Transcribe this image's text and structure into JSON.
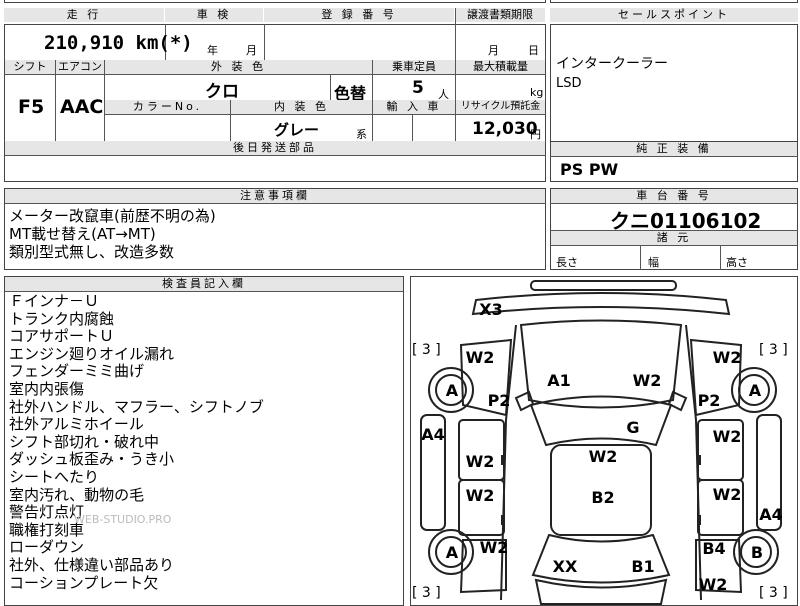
{
  "header": {
    "mileage_label": "走 行",
    "inspection_label": "車 検",
    "registration_label": "登 録 番 号",
    "transfer_deadline_label": "譲渡書類期限",
    "sales_point_label": "セールスポイント"
  },
  "mileage": "210,910 km(*)",
  "inspection": {
    "year_unit": "年",
    "month_unit": "月"
  },
  "transfer_deadline": {
    "month_unit": "月",
    "day_unit": "日"
  },
  "sales_points": [
    "インタークーラー",
    "LSD"
  ],
  "spec": {
    "shift_label": "シフト",
    "shift": "F5",
    "aircon_label": "エアコン",
    "aircon": "AAC",
    "exterior_label": "外 装 色",
    "exterior_color": "クロ",
    "color_change_label": "色替",
    "capacity_label": "乗車定員",
    "capacity": "5",
    "capacity_unit": "人",
    "max_load_label": "最大積載量",
    "max_load_unit": "kg",
    "color_no_label": "カラーNo.",
    "interior_label": "内 装 色",
    "interior_color": "グレー",
    "interior_suffix": "系",
    "import_label": "輸 入 車",
    "recycle_label": "リサイクル預託金",
    "recycle_fee": "12,030",
    "recycle_unit": "円"
  },
  "later_parts_label": "後日発送部品",
  "genuine_equipment_label": "純 正 装 備",
  "genuine_equipment": "PS PW",
  "notes_label": "注意事項欄",
  "notes": [
    "メーター改竄車(前歴不明の為)",
    "MT載せ替え(AT→MT)",
    "類別型式無し、改造多数"
  ],
  "chassis_label": "車 台 番 号",
  "chassis_number": "クニ01106102",
  "dims_label": "諸 元",
  "dims": {
    "length": "長さ",
    "width": "幅",
    "height": "高さ"
  },
  "inspector_label": "検査員記入欄",
  "inspector_notes": [
    "Ｆインナ－Ｕ",
    "トランク内腐蝕",
    "コアサポートＵ",
    "エンジン廻りオイル漏れ",
    "フェンダーミミ曲げ",
    "室内内張傷",
    "社外ハンドル、マフラー、シフトノブ",
    "社外アルミホイール",
    "シフト部切れ・破れ中",
    "ダッシュ板歪み・うき小",
    "シートへたり",
    "室内汚れ、動物の毛",
    "警告灯点灯",
    "職権打刻車",
    "ローダウン",
    "社外、仕様違い部品あり",
    "コーションプレート欠"
  ],
  "watermark": "WEB-STUDIO.PRO",
  "diagram": {
    "tire_brackets": [
      "[ 3 ]",
      "[ 3 ]",
      "[ 3 ]",
      "[ 3 ]"
    ],
    "marks": {
      "x3": "X3",
      "w2_left_upper": "W2",
      "w2_right_upper": "W2",
      "a_left_front": "A",
      "a_right_front": "A",
      "a1": "A1",
      "w2_hood_right": "W2",
      "p2_left": "P2",
      "p2_right": "P2",
      "a4_left": "A4",
      "g": "G",
      "w2_right_door1": "W2",
      "w2_left_door1": "W2",
      "w2_roof": "W2",
      "w2_left_door2": "W2",
      "w2_right_door2": "W2",
      "b2": "B2",
      "a4_right": "A4",
      "a_left_rear": "A",
      "w2_left_rear": "W2",
      "b4": "B4",
      "b_right_rear": "B",
      "xx": "XX",
      "b1": "B1",
      "w2_right_rear": "W2"
    }
  }
}
